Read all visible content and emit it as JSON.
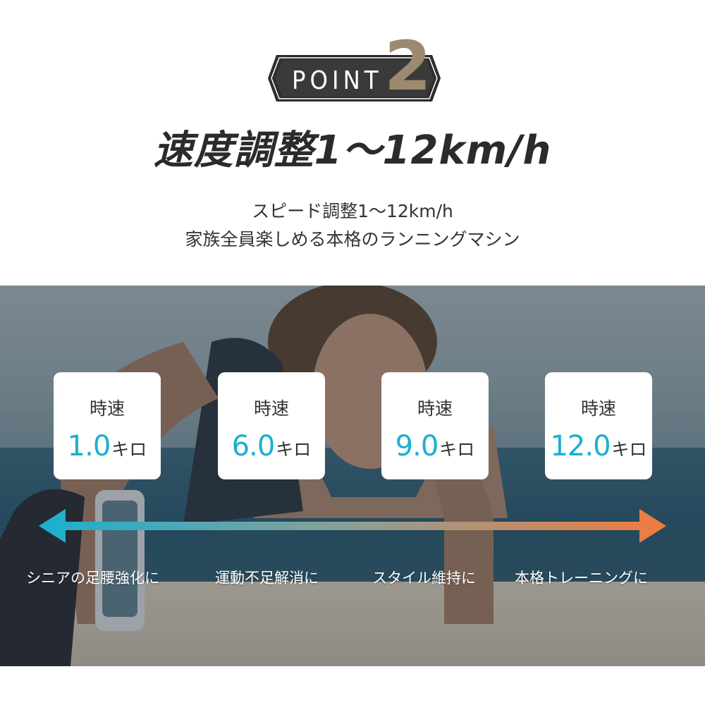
{
  "point": {
    "label": "POINT",
    "number": "2"
  },
  "title": "速度調整1～12km/h",
  "subtitle": {
    "line1": "スピード調整1～12km/h",
    "line2_highlight": "家族全員楽しめる",
    "line2_rest": "本格のランニングマシン"
  },
  "speeds": [
    {
      "label": "時速",
      "value": "1.0",
      "unit": "キロ"
    },
    {
      "label": "時速",
      "value": "6.0",
      "unit": "キロ"
    },
    {
      "label": "時速",
      "value": "9.0",
      "unit": "キロ"
    },
    {
      "label": "時速",
      "value": "12.0",
      "unit": "キロ"
    }
  ],
  "purposes": [
    "シニアの足腰強化に",
    "運動不足解消に",
    "スタイル維持に",
    "本格トレーニングに"
  ],
  "colors": {
    "accent_cyan": "#1ab0cf",
    "accent_orange": "#f07b3f",
    "badge_dark": "#333333",
    "badge_gold": "#9b8a6f"
  }
}
